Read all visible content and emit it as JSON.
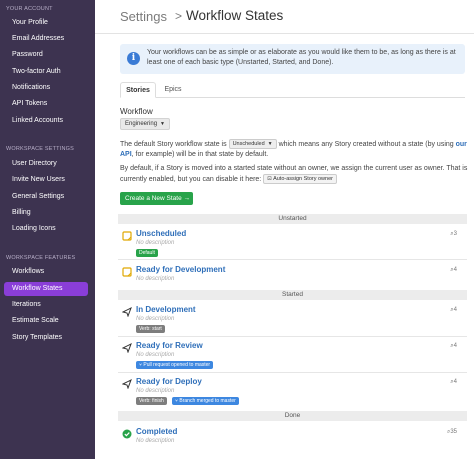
{
  "sidebar": {
    "your_account_heading": "YOUR ACCOUNT",
    "account_items": [
      "Your Profile",
      "Email Addresses",
      "Password",
      "Two-factor Auth",
      "Notifications",
      "API Tokens",
      "Linked Accounts"
    ],
    "workspace_settings_heading": "WORKSPACE SETTINGS",
    "settings_items": [
      "User Directory",
      "Invite New Users",
      "General Settings",
      "Billing",
      "Loading Icons"
    ],
    "workspace_features_heading": "WORKSPACE FEATURES",
    "feature_items": [
      "Workflows",
      "Workflow States",
      "Iterations",
      "Estimate Scale",
      "Story Templates"
    ],
    "active_item": "Workflow States",
    "bg_color": "#3d3350",
    "active_color": "#8a3ed8"
  },
  "header": {
    "breadcrumb_parent": "Settings",
    "breadcrumb_separator": ">",
    "title": "Workflow States"
  },
  "info": {
    "icon": "info-icon",
    "text": "Your workflows can be as simple or as elaborate as you would like them to be, as long as there is at least one of each basic type (Unstarted, Started, and Done)."
  },
  "tabs": [
    "Stories",
    "Epics"
  ],
  "active_tab": "Stories",
  "workflow": {
    "label": "Workflow",
    "selected": "Engineering"
  },
  "default_state": {
    "text_before": "The default Story workflow state is",
    "selected": "Unscheduled",
    "text_middle": "which means any Story created without a state (by using",
    "link": "our API",
    "text_after": ", for example) will be in that state by default."
  },
  "auto_assign": {
    "text": "By default, if a Story is moved into a started state without an owner, we assign the current user as owner. That is currently enabled, but you can disable it here:",
    "button_label": "Auto-assign Story owner"
  },
  "create_button": "Create a New State →",
  "sections": {
    "unstarted": "Unstarted",
    "started": "Started",
    "done": "Done"
  },
  "states": [
    {
      "name": "Unscheduled",
      "description": "No description",
      "count": "3",
      "icon": "unstarted-icon",
      "badges": [
        "Default"
      ]
    },
    {
      "name": "Ready for Development",
      "description": "No description",
      "count": "4",
      "icon": "unstarted-icon",
      "badges": []
    },
    {
      "name": "In Development",
      "description": "No description",
      "count": "4",
      "icon": "started-icon",
      "badges": [
        "Verb: start"
      ]
    },
    {
      "name": "Ready for Review",
      "description": "No description",
      "count": "4",
      "icon": "started-icon",
      "badges": [
        "⑂ Pull request opened to master"
      ]
    },
    {
      "name": "Ready for Deploy",
      "description": "No description",
      "count": "4",
      "icon": "started-icon",
      "badges": [
        "Verb: finish",
        "⑂ Branch merged to master"
      ]
    },
    {
      "name": "Completed",
      "description": "No description",
      "count": "35",
      "icon": "done-icon",
      "badges": []
    }
  ]
}
